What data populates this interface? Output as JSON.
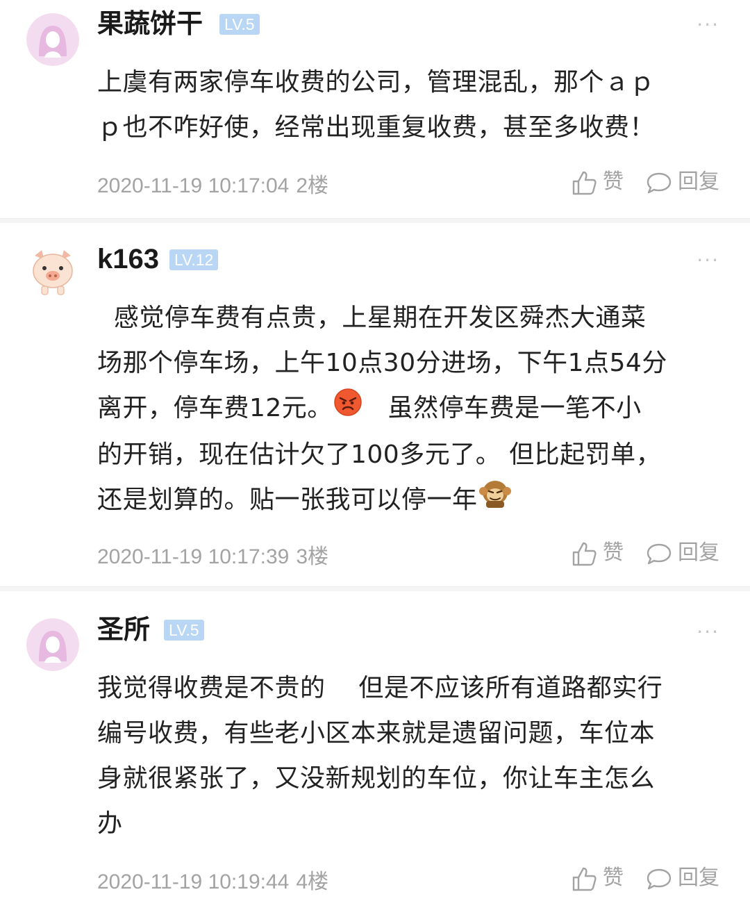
{
  "comments": [
    {
      "username": "果蔬饼干",
      "level": "LV.5",
      "lines": [
        "上虞有两家停车收费的公司，管理混乱，那个ａｐ",
        "ｐ也不咋好使，经常出现重复收费，甚至多收费！"
      ],
      "timestamp": "2020-11-19 10:17:04",
      "floor": "2楼",
      "like_label": "赞",
      "reply_label": "回复",
      "more": "···"
    },
    {
      "username": "k163",
      "level": "LV.12",
      "lines": [
        "  感觉停车费有点贵，上星期在开发区舜杰大通菜",
        "场那个停车场，上午10点30分进场，下午1点54分",
        "离开，停车费12元。",
        "的开销，现在估计欠了100多元了。 但比起罚单，",
        "还是划算的。贴一张我可以停一年"
      ],
      "line3_after_emoji": "   虽然停车费是一笔不小",
      "timestamp": "2020-11-19 10:17:39",
      "floor": "3楼",
      "like_label": "赞",
      "reply_label": "回复",
      "more": "···"
    },
    {
      "username": "圣所",
      "level": "LV.5",
      "lines": [
        "我觉得收费是不贵的    但是不应该所有道路都实行",
        "编号收费，有些老小区本来就是遗留问题，车位本",
        "身就很紧张了，又没新规划的车位，你让车主怎么",
        "办"
      ],
      "timestamp": "2020-11-19 10:19:44",
      "floor": "4楼",
      "like_label": "赞",
      "reply_label": "回复",
      "more": "···"
    }
  ],
  "colors": {
    "level_badge": "#b9d6f5",
    "meta_text": "#a3a3a3",
    "divider": "#f4f4f4",
    "avatar_pink": "#f3dcef"
  },
  "icons": [
    "female-avatar-icon",
    "pig-avatar-icon",
    "thumb-up-icon",
    "speech-bubble-icon",
    "angry-face-emoji",
    "monkey-emoji"
  ]
}
